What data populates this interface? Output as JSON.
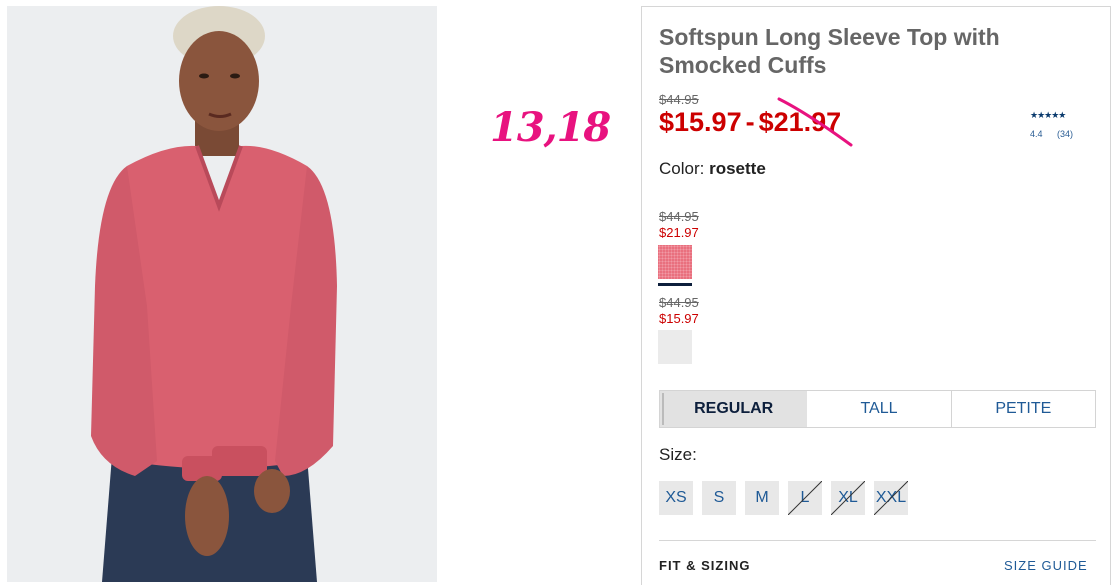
{
  "annotation": "13,18",
  "product": {
    "title": "Softspun Long Sleeve Top with Smocked Cuffs",
    "old_price": "$44.95",
    "price_low": "$15.97",
    "price_separator": "-",
    "price_high": "$21.97",
    "rating": {
      "stars": "★★★★★",
      "score": "4.4",
      "count": "(34)",
      "value": 4.4
    },
    "color_label": "Color:",
    "color_value": "rosette",
    "swatches": [
      {
        "was": "$44.95",
        "now": "$21.97",
        "color": "#e9707e",
        "selected": true
      },
      {
        "was": "$44.95",
        "now": "$15.97",
        "color": "#ebebeb",
        "selected": false
      }
    ],
    "fit_tabs": [
      {
        "label": "REGULAR",
        "active": true
      },
      {
        "label": "TALL",
        "active": false
      },
      {
        "label": "PETITE",
        "active": false
      }
    ],
    "size_label": "Size:",
    "sizes": [
      {
        "label": "XS",
        "available": true
      },
      {
        "label": "S",
        "available": true
      },
      {
        "label": "M",
        "available": true
      },
      {
        "label": "L",
        "available": false
      },
      {
        "label": "XL",
        "available": false
      },
      {
        "label": "XXL",
        "available": false
      }
    ],
    "fit_sizing_label": "FIT & SIZING",
    "size_guide_label": "SIZE GUIDE"
  },
  "colors": {
    "sale_red": "#cc0000",
    "link_blue": "#1f5a96",
    "annotation_pink": "#e8127f",
    "swatch_rosette": "#e9707e"
  }
}
